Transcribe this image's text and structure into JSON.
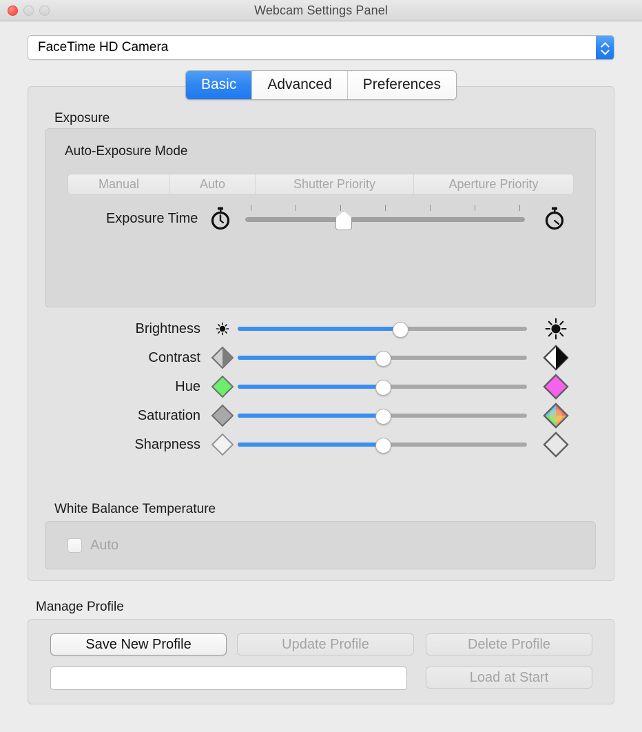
{
  "window": {
    "title": "Webcam Settings Panel",
    "traffic_lights": [
      "close",
      "minimize",
      "zoom"
    ]
  },
  "camera_selector": {
    "selected": "FaceTime HD Camera",
    "icon": "popup-arrows-icon"
  },
  "tabs": [
    {
      "label": "Basic",
      "active": true
    },
    {
      "label": "Advanced",
      "active": false
    },
    {
      "label": "Preferences",
      "active": false
    }
  ],
  "exposure": {
    "group_label": "Exposure",
    "auto_exposure_mode_label": "Auto-Exposure Mode",
    "modes": [
      {
        "label": "Manual",
        "enabled": false
      },
      {
        "label": "Auto",
        "enabled": false
      },
      {
        "label": "Shutter Priority",
        "enabled": false
      },
      {
        "label": "Aperture Priority",
        "enabled": false
      }
    ],
    "exposure_time": {
      "label": "Exposure Time",
      "value_percent": 35,
      "ticks": 7,
      "icon_left": "stopwatch-short-icon",
      "icon_right": "stopwatch-long-icon"
    }
  },
  "adjustments": [
    {
      "label": "Brightness",
      "value_percent": 56,
      "icon_left": "sun-small-icon",
      "icon_right": "sun-large-icon",
      "color_left": "#000000",
      "color_right": "#000000"
    },
    {
      "label": "Contrast",
      "value_percent": 50,
      "icon_left": "contrast-low-diamond-icon",
      "icon_right": "contrast-high-diamond-icon",
      "color_left": "#b9b9b9",
      "color_right": "#ffffff"
    },
    {
      "label": "Hue",
      "value_percent": 50,
      "icon_left": "hue-green-diamond-icon",
      "icon_right": "hue-magenta-diamond-icon",
      "color_left": "#6ced6c",
      "color_right": "#f562ec"
    },
    {
      "label": "Saturation",
      "value_percent": 50,
      "icon_left": "saturation-gray-diamond-icon",
      "icon_right": "saturation-color-diamond-icon",
      "color_left": "#a8a8a8",
      "color_right": "#ff6b6b"
    },
    {
      "label": "Sharpness",
      "value_percent": 50,
      "icon_left": "sharpness-low-diamond-icon",
      "icon_right": "sharpness-high-diamond-icon",
      "color_left": "#f2f2f2",
      "color_right": "#e8e8e8"
    }
  ],
  "white_balance": {
    "group_label": "White Balance Temperature",
    "auto_label": "Auto",
    "auto_checked": false,
    "auto_enabled": false
  },
  "manage_profile": {
    "group_label": "Manage Profile",
    "buttons": [
      {
        "label": "Save New Profile",
        "enabled": true
      },
      {
        "label": "Update Profile",
        "enabled": false
      },
      {
        "label": "Delete Profile",
        "enabled": false
      },
      {
        "label": "Load at Start",
        "enabled": false
      }
    ],
    "profile_selected": ""
  },
  "colors": {
    "accent_blue": "#3a8ef0",
    "window_bg": "#ececec",
    "panel_bg": "#e3e3e3",
    "inner_bg": "#d8d8d8",
    "track_gray": "#a8a8a8",
    "disabled_text": "#a4a4a4"
  }
}
